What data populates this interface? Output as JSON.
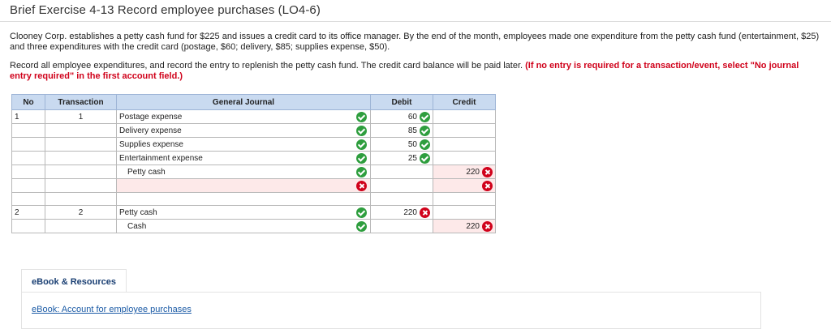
{
  "page": {
    "title": "Brief Exercise 4-13 Record employee purchases (LO4-6)",
    "paragraph1": "Clooney Corp. establishes a petty cash fund for $225 and issues a credit card to its office manager. By the end of the month, employees made one expenditure from the petty cash fund (entertainment, $25) and three expenditures with the credit card (postage, $60; delivery, $85; supplies expense, $50).",
    "paragraph2_normal": "Record all employee expenditures, and record the entry to replenish the petty cash fund. The credit card balance will be paid later. ",
    "paragraph2_red": "(If no entry is required for a transaction/event, select \"No journal entry required\" in the first account field.)"
  },
  "journal": {
    "headers": {
      "no": "No",
      "transaction": "Transaction",
      "general_journal": "General Journal",
      "debit": "Debit",
      "credit": "Credit"
    },
    "rows": [
      {
        "no": "1",
        "transaction": "1",
        "account": "Postage expense",
        "debit": "60"
      },
      {
        "account": "Delivery expense",
        "debit": "85"
      },
      {
        "account": "Supplies expense",
        "debit": "50"
      },
      {
        "account": "Entertainment expense",
        "debit": "25"
      },
      {
        "account": "Petty cash",
        "credit": "220"
      },
      {
        "account": "",
        "credit": ""
      },
      {
        "no": "2",
        "transaction": "2",
        "account": "Petty cash",
        "debit": "220"
      },
      {
        "account": "Cash",
        "credit": "220"
      }
    ]
  },
  "resources": {
    "tab_label": "eBook & Resources",
    "link_label": "eBook: Account for employee purchases"
  },
  "colors": {
    "header_bg": "#c9daf0",
    "correct": "#2e9e3e",
    "incorrect": "#d0021b",
    "link": "#1a5aa5"
  }
}
